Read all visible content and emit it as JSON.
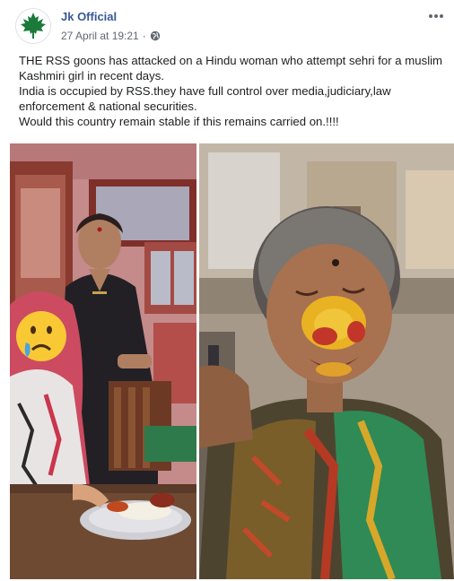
{
  "post": {
    "author": "Jk Official",
    "date": "27 April at 19:21",
    "date_separator": "·",
    "privacy_icon": "globe-icon",
    "avatar_icon": "maple-leaf-icon",
    "more_icon": "more-horizontal-icon",
    "text_lines": [
      "THE RSS goons has attacked on a Hindu woman who attempt sehri for a muslim Kashmiri girl in recent days.",
      "India is occupied by RSS.they have full control over media,judiciary,law enforcement & national securities.",
      "Would this country remain stable if this remains carried on.!!!!"
    ]
  },
  "photos": [
    {
      "name": "photo-left",
      "subject": "two women seated at a table with a plate of food",
      "overlay_icon": "sad-face-emoji-icon"
    },
    {
      "name": "photo-right",
      "subject": "injured woman with turmeric on face"
    }
  ],
  "colors": {
    "author_link": "#385898",
    "meta_text": "#606770",
    "body_text": "#1c1e21",
    "avatar_leaf": "#1a7a3a"
  }
}
